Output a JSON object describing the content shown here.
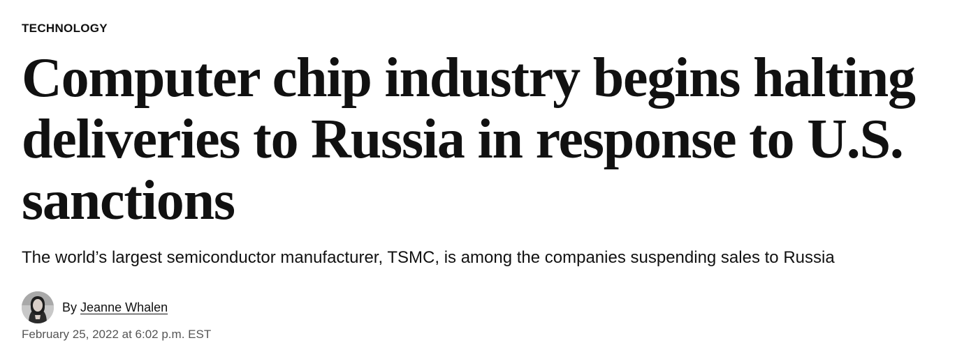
{
  "article": {
    "section": "TECHNOLOGY",
    "headline": "Computer chip industry begins halting deliveries to Russia in response to U.S. sanctions",
    "dek": "The world’s largest semiconductor manufacturer, TSMC, is among the companies suspending sales to Russia",
    "byline": {
      "prefix": "By",
      "author": "Jeanne Whalen",
      "avatar_icon": "author-photo"
    },
    "timestamp": "February 25, 2022 at 6:02 p.m. EST"
  }
}
